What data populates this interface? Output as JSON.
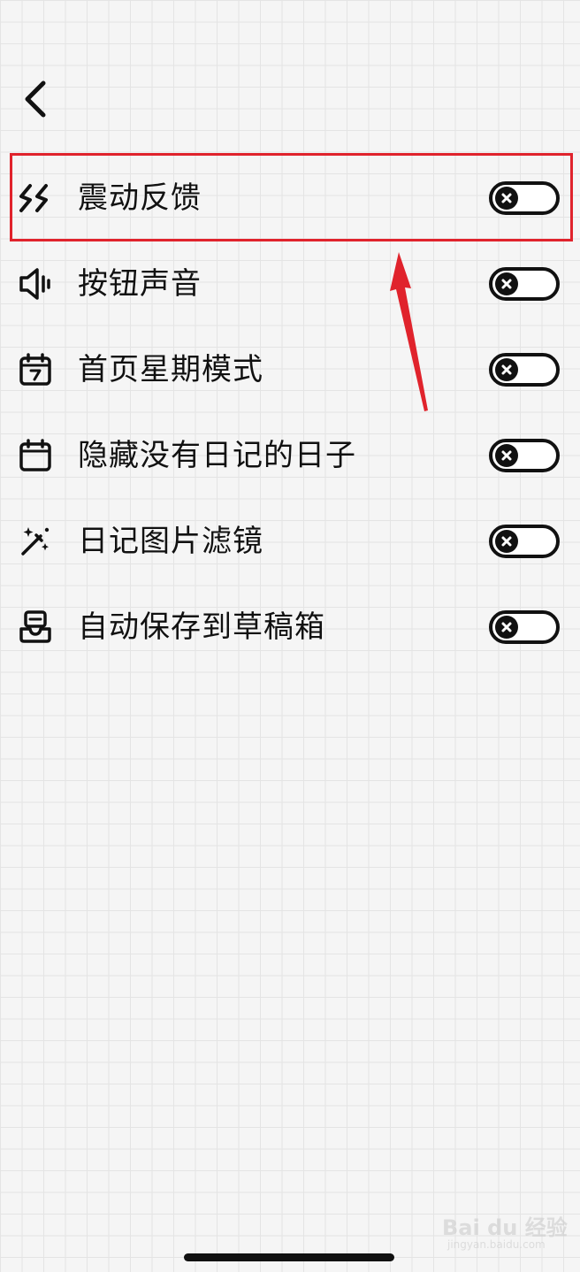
{
  "settings": [
    {
      "icon": "vibration-icon",
      "label": "震动反馈",
      "enabled": false
    },
    {
      "icon": "speaker-icon",
      "label": "按钮声音",
      "enabled": false
    },
    {
      "icon": "calendar-week-icon",
      "label": "首页星期模式",
      "enabled": false
    },
    {
      "icon": "calendar-icon",
      "label": "隐藏没有日记的日子",
      "enabled": false
    },
    {
      "icon": "magic-wand-icon",
      "label": "日记图片滤镜",
      "enabled": false
    },
    {
      "icon": "inbox-draft-icon",
      "label": "自动保存到草稿箱",
      "enabled": false
    }
  ],
  "annotation": {
    "color": "#e0232c",
    "highlighted_setting": "震动反馈"
  },
  "watermark": {
    "main": "Bai du 经验",
    "sub": "jingyan.baidu.com"
  }
}
